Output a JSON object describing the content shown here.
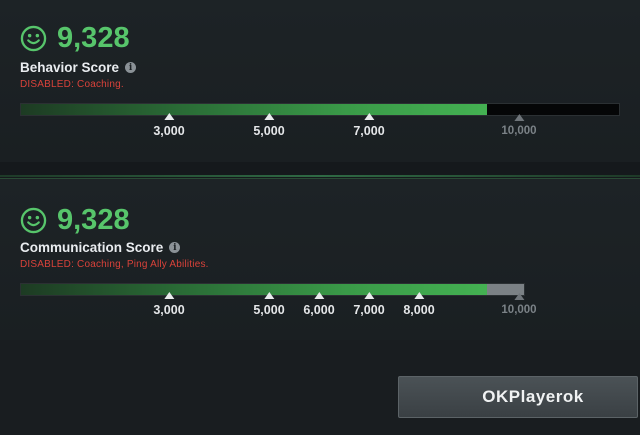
{
  "behavior": {
    "score": "9,328",
    "label": "Behavior Score",
    "info_icon": "i",
    "disabled_text": "DISABLED:  Coaching.",
    "progress_fraction": 0.9328,
    "ticks": [
      {
        "value": "3,000"
      },
      {
        "value": "5,000"
      },
      {
        "value": "7,000"
      },
      {
        "value": "10,000"
      }
    ]
  },
  "communication": {
    "score": "9,328",
    "label": "Communication Score",
    "info_icon": "i",
    "disabled_text": "DISABLED:  Coaching, Ping Ally Abilities.",
    "progress_fraction": 0.9328,
    "ticks": [
      {
        "value": "3,000"
      },
      {
        "value": "5,000"
      },
      {
        "value": "6,000"
      },
      {
        "value": "7,000"
      },
      {
        "value": "8,000"
      },
      {
        "value": "10,000"
      }
    ]
  },
  "footer": {
    "ok_label": "OKPlayerok"
  },
  "colors": {
    "score_green": "#57c56b",
    "disabled_red": "#d9423a",
    "bar_green": "#44b152"
  },
  "icons": {
    "score_icon": "smiley-face-icon",
    "info": "info-icon"
  }
}
